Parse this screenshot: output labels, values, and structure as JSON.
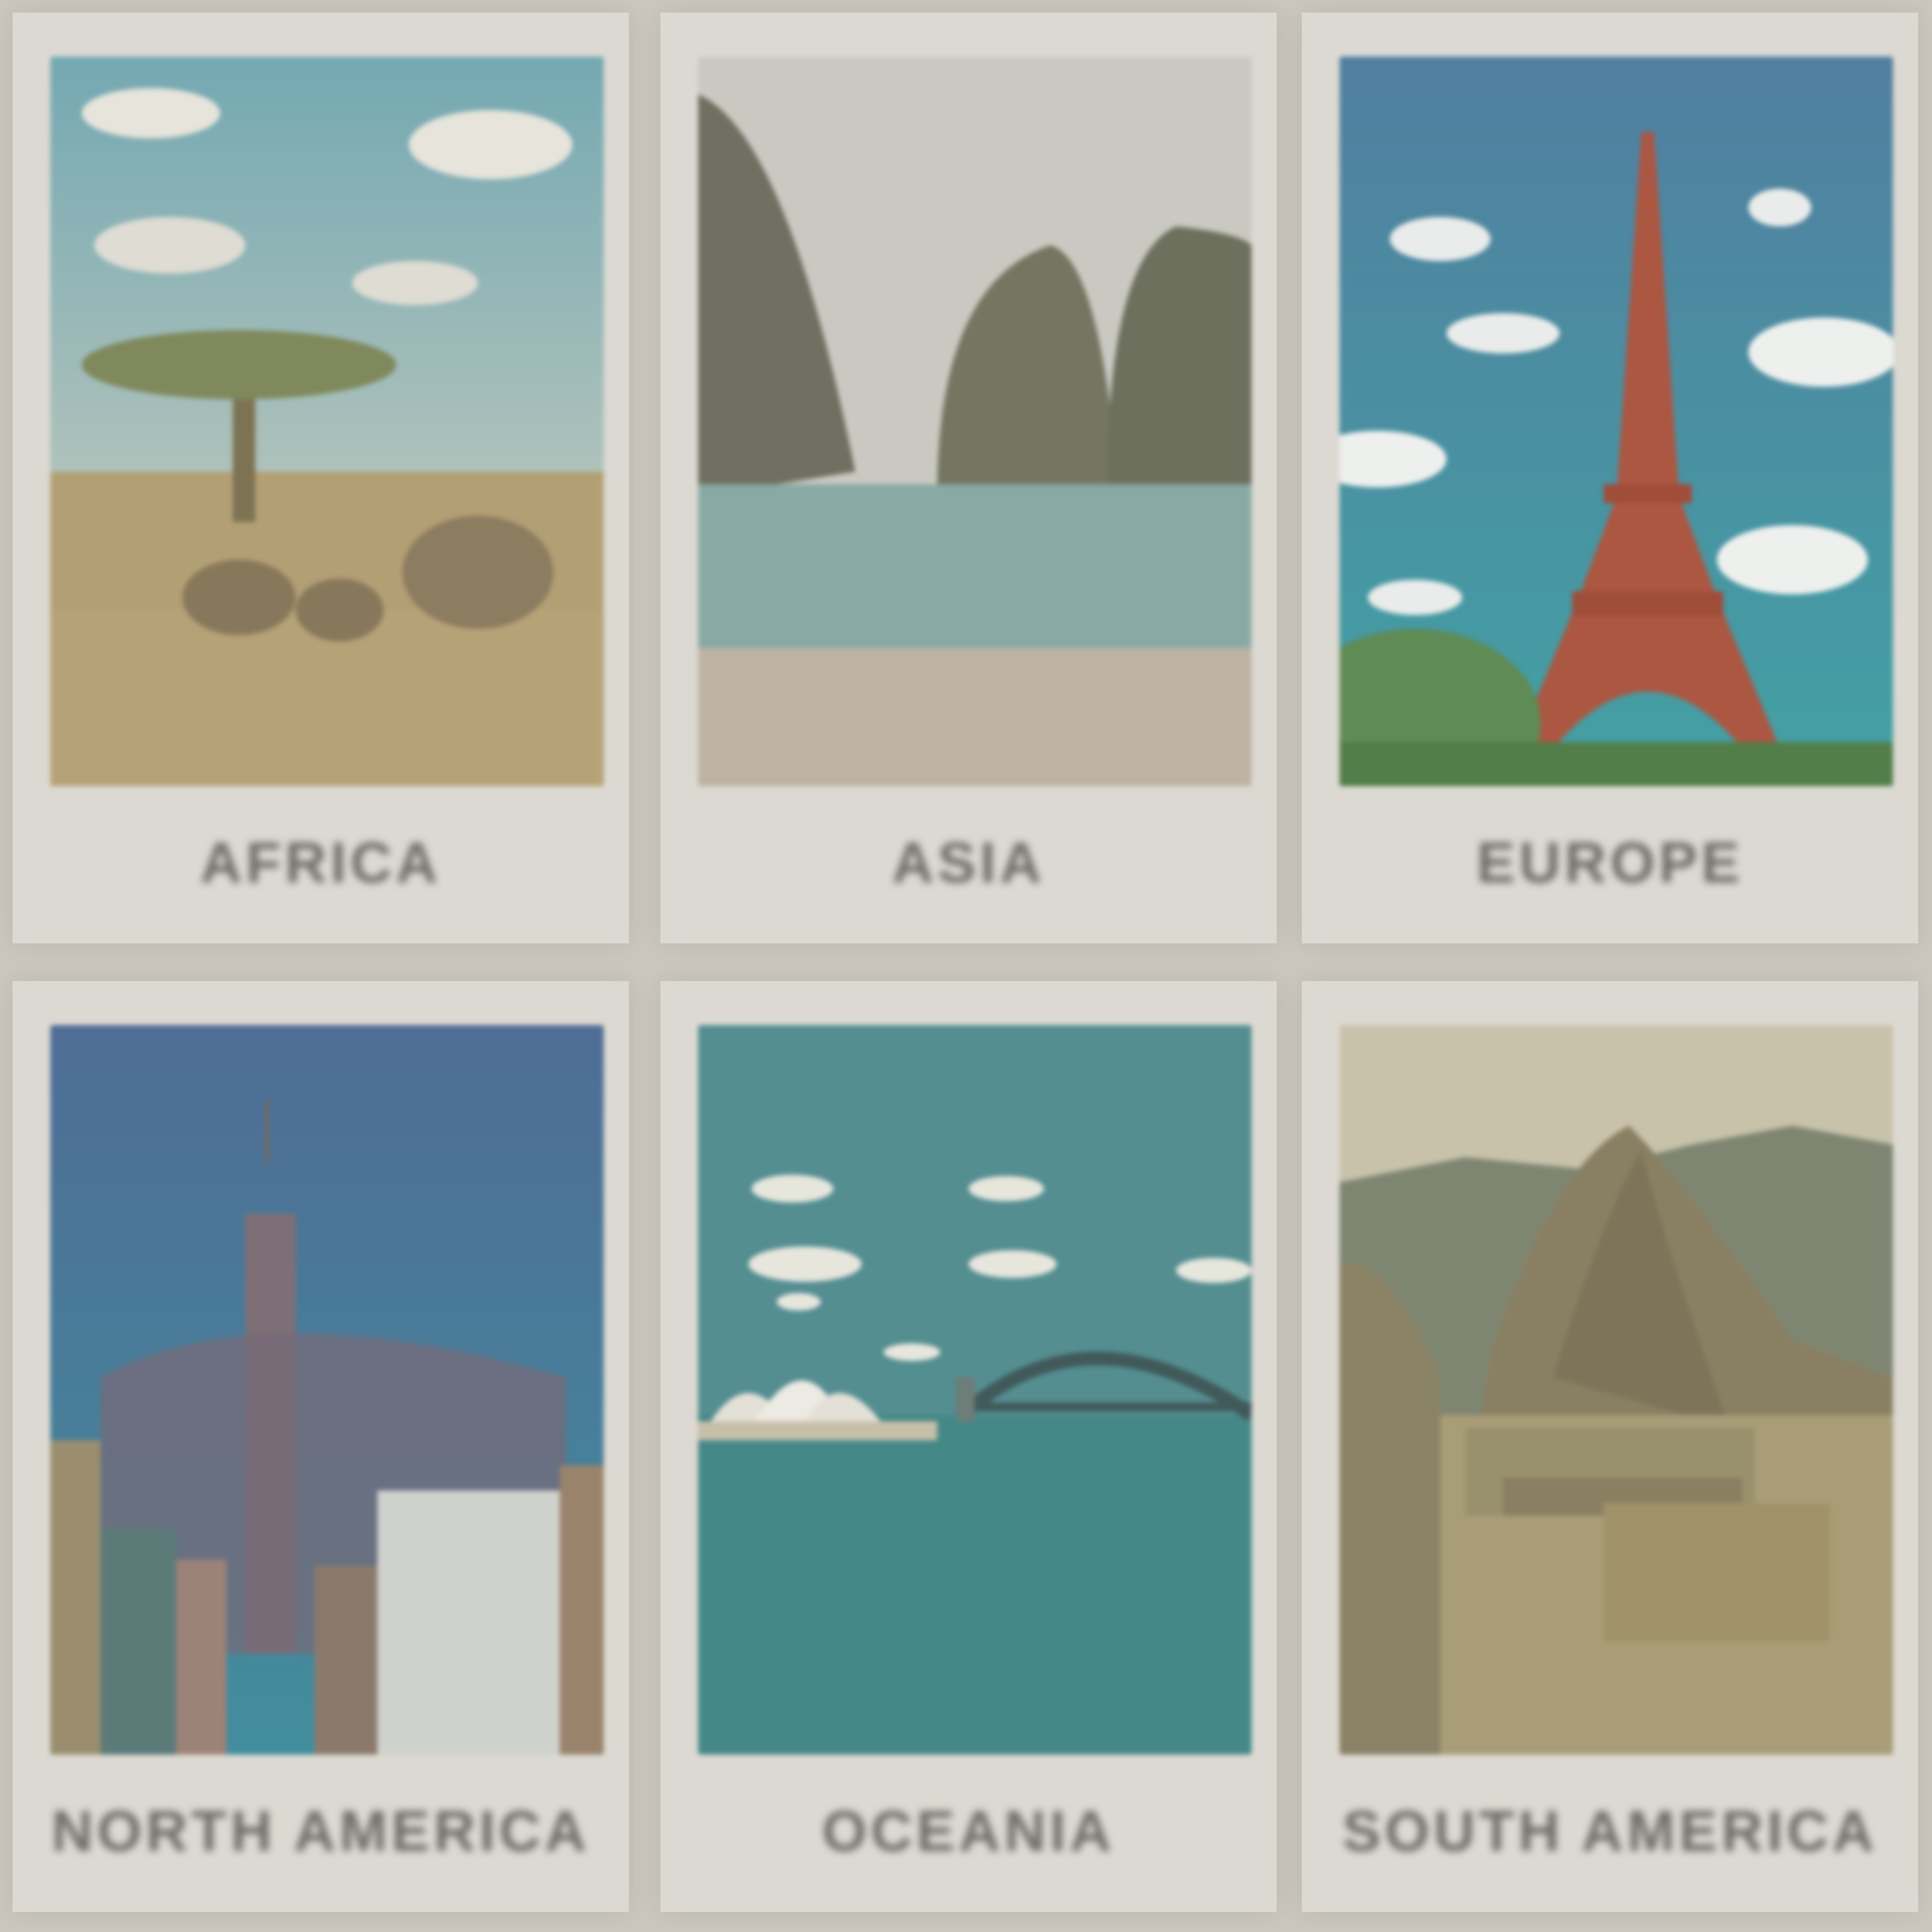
{
  "continents": [
    {
      "label": "AFRICA",
      "image": "savanna-acacia-elephants-image"
    },
    {
      "label": "ASIA",
      "image": "limestone-cliffs-lagoon-image"
    },
    {
      "label": "EUROPE",
      "image": "eiffel-tower-image"
    },
    {
      "label": "NORTH AMERICA",
      "image": "new-york-skyline-image"
    },
    {
      "label": "OCEANIA",
      "image": "sydney-opera-house-harbour-bridge-image"
    },
    {
      "label": "SOUTH AMERICA",
      "image": "machu-picchu-image"
    }
  ],
  "colors": {
    "background": "#cbc7bf",
    "card": "#dcd9d2",
    "caption": "#6e6b66"
  }
}
